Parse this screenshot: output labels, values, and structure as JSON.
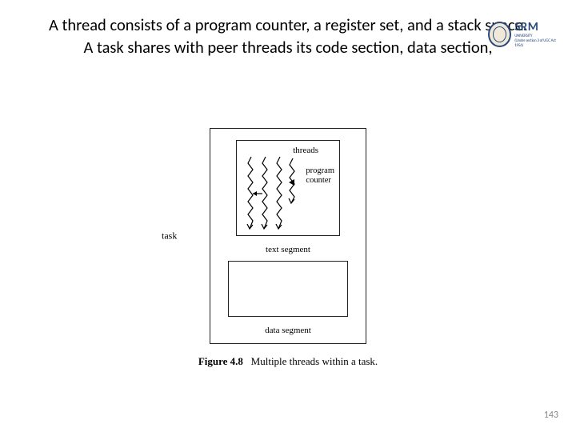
{
  "header": {
    "line1": "A thread consists of a program counter, a register set, and a stack space.",
    "line2": "A task shares with peer threads its code section, data section,"
  },
  "logo": {
    "main": "SRM",
    "sub1": "UNIVERSITY",
    "sub2": "(Under section 3 of UGC Act 1956)"
  },
  "figure": {
    "task_label": "task",
    "threads_label": "threads",
    "pc_label_l1": "program",
    "pc_label_l2": "counter",
    "text_segment_label": "text segment",
    "data_segment_label": "data segment",
    "caption_bold": "Figure 4.8",
    "caption_rest": "Multiple threads within a task."
  },
  "page_number": "143"
}
